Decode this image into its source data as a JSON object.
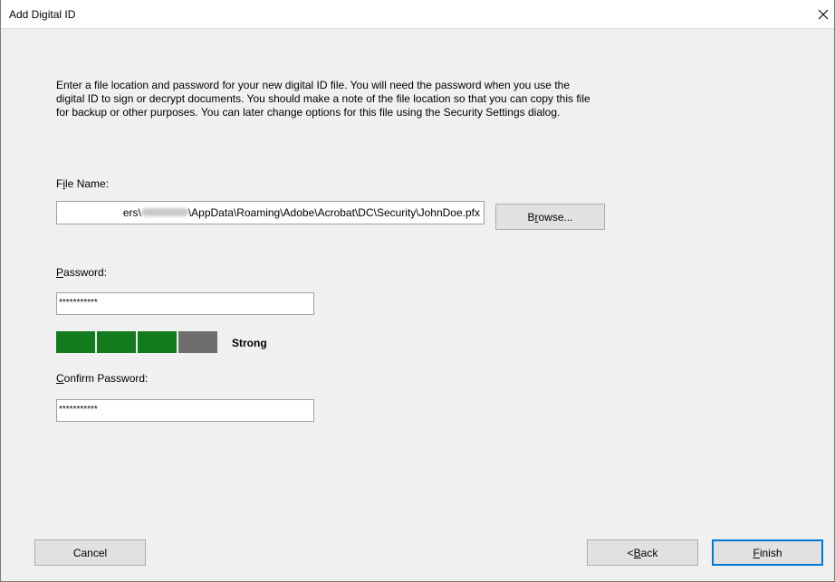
{
  "window": {
    "title": "Add Digital ID"
  },
  "intro_text": "Enter a file location and password for your new digital ID file. You will need the password when you use the digital ID to sign or decrypt documents. You should make a note of the file location so that you can copy this file for backup or other purposes. You can later change options for this file using the Security Settings dialog.",
  "file_name": {
    "label_mnemonic": "i",
    "label_before": "F",
    "label_after": "le Name:",
    "value_prefix": "ers\\",
    "value_suffix": "\\AppData\\Roaming\\Adobe\\Acrobat\\DC\\Security\\JohnDoe.pfx",
    "browse_before": "B",
    "browse_mnemonic": "r",
    "browse_after": "owse..."
  },
  "password": {
    "label_mnemonic": "P",
    "label_after": "assword:",
    "value": "***********",
    "strength_label": "Strong",
    "strength_filled": 3,
    "strength_total": 4,
    "strength_color": "#137a1e",
    "empty_color": "#6e6e6e"
  },
  "confirm_password": {
    "label_mnemonic": "C",
    "label_after": "onfirm Password:",
    "value": "***********"
  },
  "buttons": {
    "cancel": "Cancel",
    "back_before": "< ",
    "back_mnemonic": "B",
    "back_after": "ack",
    "finish_mnemonic": "F",
    "finish_after": "inish"
  }
}
